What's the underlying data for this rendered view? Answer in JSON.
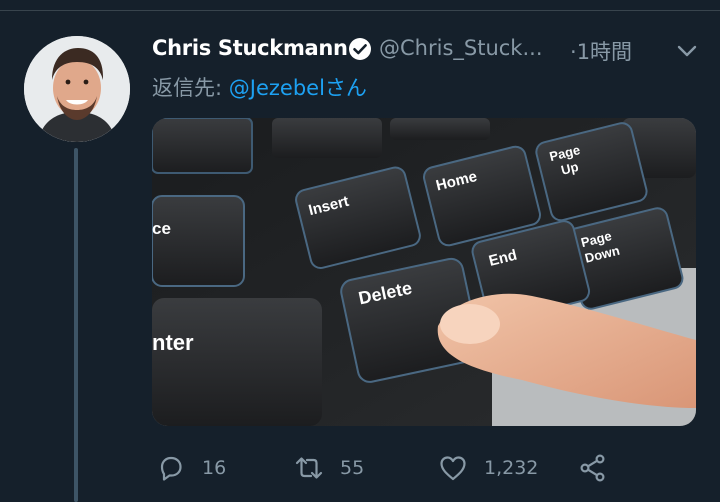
{
  "tweet": {
    "author_name": "Chris Stuckmann",
    "author_handle": "@Chris_Stuck...",
    "time_separator": "·",
    "time": "1時間",
    "reply_prefix": "返信先: ",
    "reply_mention": "@Jezebelさん",
    "verified": true
  },
  "media": {
    "keys": {
      "insert": "Insert",
      "home": "Home",
      "page_up_line1": "Page",
      "page_up_line2": "Up",
      "page_down_line1": "Page",
      "page_down_line2": "Down",
      "delete": "Delete",
      "end": "End",
      "enter": "nter",
      "ce": "ce"
    }
  },
  "actions": {
    "reply": {
      "icon": "reply-icon",
      "count": "16"
    },
    "retweet": {
      "icon": "retweet-icon",
      "count": "55"
    },
    "like": {
      "icon": "heart-icon",
      "count": "1,232"
    },
    "share": {
      "icon": "share-icon"
    }
  },
  "colors": {
    "background": "#15202b",
    "secondary_text": "#8899a6",
    "link": "#1da1f2",
    "divider": "#38444d"
  }
}
